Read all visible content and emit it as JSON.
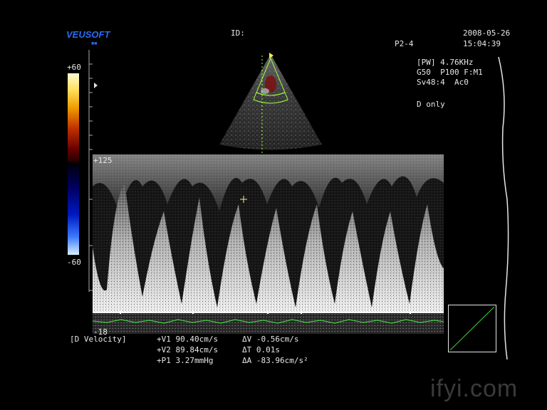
{
  "header": {
    "logo": "EUSOFT",
    "id_label": "ID:",
    "probe": "P2-4",
    "date": "2008-05-26",
    "time": "15:04:39"
  },
  "params": {
    "line1": "[PW] 4.76KHz",
    "line2": "G50  P100 F:M1",
    "line3": "Sv48:4  Ac0",
    "mode": "D only"
  },
  "colorbar": {
    "top_label": "+60",
    "bottom_label": "-60"
  },
  "doppler_scale": {
    "top_label": "+125",
    "bottom_label": "-18"
  },
  "measurements": {
    "mode_label": "[D Velocity]",
    "v1": "+V1 90.40cm/s",
    "v2": "+V2 89.84cm/s",
    "p1": "+P1 3.27mmHg",
    "dv": "ΔV -0.56cm/s",
    "dt": "ΔT 0.01s",
    "da": "ΔA -83.96cm/s²"
  },
  "watermark": "ifyi.com",
  "colors": {
    "logo": "#2a6cf0",
    "ecg": "#40d040",
    "sector_overlay": "#a0ff40"
  }
}
